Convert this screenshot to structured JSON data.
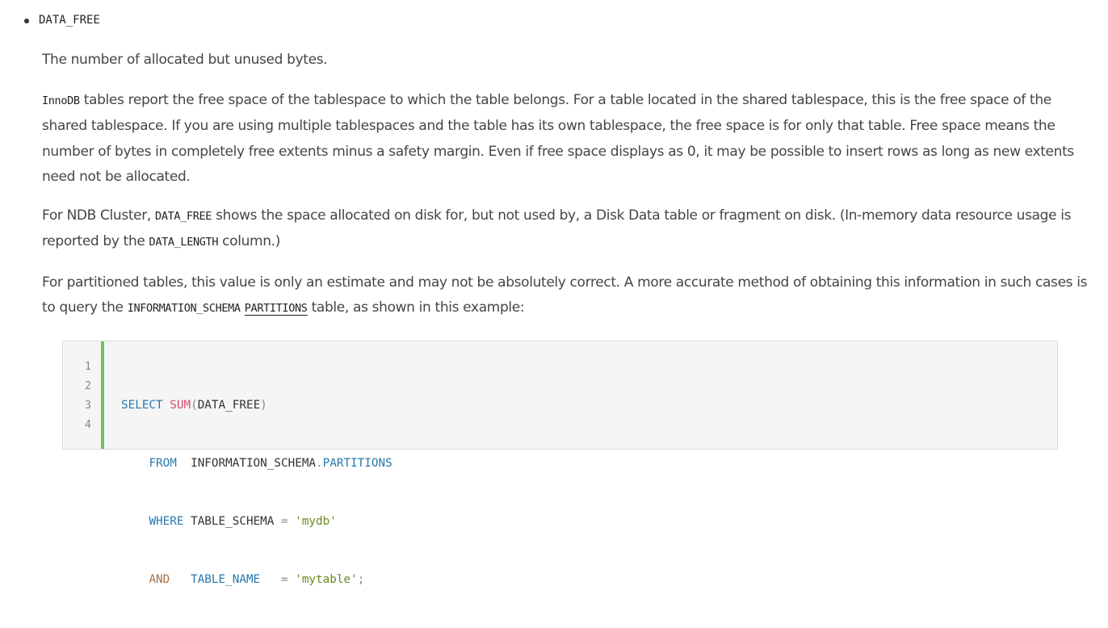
{
  "term": "DATA_FREE",
  "paragraphs": {
    "p1": "The number of allocated but unused bytes.",
    "p2_code": "InnoDB",
    "p2_text": " tables report the free space of the tablespace to which the table belongs. For a table located in the shared tablespace, this is the free space of the shared tablespace. If you are using multiple tablespaces and the table has its own tablespace, the free space is for only that table. Free space means the number of bytes in completely free extents minus a safety margin. Even if free space displays as 0, it may be possible to insert rows as long as new extents need not be allocated.",
    "p3_a": "For NDB Cluster, ",
    "p3_code1": "DATA_FREE",
    "p3_b": " shows the space allocated on disk for, but not used by, a Disk Data table or fragment on disk. (In-memory data resource usage is reported by the ",
    "p3_code2": "DATA_LENGTH",
    "p3_c": " column.)",
    "p4_a": "For partitioned tables, this value is only an estimate and may not be absolutely correct. A more accurate method of obtaining this information in such cases is to query the ",
    "p4_code": "INFORMATION_SCHEMA",
    "p4_link": "PARTITIONS",
    "p4_b": " table, as shown in this example:"
  },
  "code_block": {
    "line_numbers": [
      "1",
      "2",
      "3",
      "4"
    ],
    "l1": {
      "kw": "SELECT",
      "fn": "SUM",
      "open": "(",
      "arg": "DATA_FREE",
      "close": ")"
    },
    "l2": {
      "indent": "    ",
      "kw": "FROM",
      "sp": "  ",
      "schema": "INFORMATION_SCHEMA",
      "dot": ".",
      "table": "PARTITIONS"
    },
    "l3": {
      "indent": "    ",
      "kw": "WHERE",
      "col": " TABLE_SCHEMA ",
      "eq": "=",
      "sp": " ",
      "str": "'mydb'"
    },
    "l4": {
      "indent": "    ",
      "kw": "AND",
      "sp1": "   ",
      "col": "TABLE_NAME",
      "sp2": "   ",
      "eq": "=",
      "sp3": " ",
      "str": "'mytable'",
      "semi": ";"
    }
  }
}
